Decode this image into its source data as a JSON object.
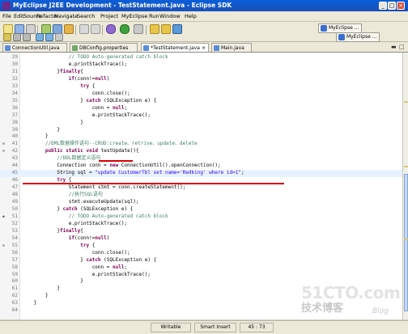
{
  "window": {
    "title": "MyEclipse J2EE Development - TestStatement.java - Eclipse SDK"
  },
  "menu": [
    "File",
    "Edit",
    "Source",
    "Refactor",
    "Navigate",
    "Search",
    "Project",
    "MyEclipse",
    "Run",
    "Window",
    "Help"
  ],
  "perspectives": [
    "MyEclipse ...",
    "MyEclipse ..."
  ],
  "tabs": [
    {
      "label": "ConnectionUtil.java",
      "icon": "java-file-icon",
      "active": false
    },
    {
      "label": "DBConfig.properties",
      "icon": "properties-file-icon",
      "active": false
    },
    {
      "label": "*TestStatement.java",
      "icon": "java-file-icon",
      "active": true
    },
    {
      "label": "Main.java",
      "icon": "java-file-icon",
      "active": false
    }
  ],
  "editor": {
    "lines": [
      {
        "n": "29",
        "text": "                // TODO Auto-generated catch block"
      },
      {
        "n": "30",
        "text": "                e.printStackTrace();"
      },
      {
        "n": "31",
        "text": "            }finally{"
      },
      {
        "n": "32",
        "text": "                if(conn!=null)"
      },
      {
        "n": "33",
        "text": "                    try {"
      },
      {
        "n": "34",
        "text": "                        conn.close();"
      },
      {
        "n": "35",
        "text": "                    } catch (SQLException e) {"
      },
      {
        "n": "36",
        "text": "                        conn = null;"
      },
      {
        "n": "37",
        "text": "                        e.printStackTrace();"
      },
      {
        "n": "38",
        "text": "                    }"
      },
      {
        "n": "39",
        "text": "            }"
      },
      {
        "n": "40",
        "text": "        }"
      },
      {
        "n": "41",
        "text": "        //DML数据操作语句--CRUD:create、retrive、update、delete"
      },
      {
        "n": "42",
        "text": "        public static void testUpdate(){"
      },
      {
        "n": "43",
        "text": "            //DDL数据定义语句"
      },
      {
        "n": "44",
        "text": "            Connection conn = new ConnectionUtil().openConnection();"
      },
      {
        "n": "45",
        "text": "            String sql = \"update CustomerTbl set name='Redking' where id=1\";"
      },
      {
        "n": "46",
        "text": "            try {"
      },
      {
        "n": "47",
        "text": "                Statement stmt = conn.createStatement();"
      },
      {
        "n": "48",
        "text": "                //执行SQL语句"
      },
      {
        "n": "49",
        "text": "                stmt.executeUpdate(sql);"
      },
      {
        "n": "50",
        "text": "            } catch (SQLException e) {"
      },
      {
        "n": "51",
        "text": "                // TODO Auto-generated catch block"
      },
      {
        "n": "52",
        "text": "                e.printStackTrace();"
      },
      {
        "n": "53",
        "text": "            }finally{"
      },
      {
        "n": "54",
        "text": "                if(conn!=null)"
      },
      {
        "n": "55",
        "text": "                    try {"
      },
      {
        "n": "56",
        "text": "                        conn.close();"
      },
      {
        "n": "57",
        "text": "                    } catch (SQLException e) {"
      },
      {
        "n": "58",
        "text": "                        conn = null;"
      },
      {
        "n": "59",
        "text": "                        e.printStackTrace();"
      },
      {
        "n": "60",
        "text": "                    }"
      },
      {
        "n": "61",
        "text": "            }"
      },
      {
        "n": "62",
        "text": "        }"
      },
      {
        "n": "63",
        "text": "    }"
      },
      {
        "n": "64",
        "text": ""
      }
    ],
    "current_line": "45"
  },
  "status": {
    "mode": "Writable",
    "insert": "Smart Insert",
    "position": "45 : 73"
  },
  "watermark": {
    "logo": "51CTO.com",
    "subtitle": "技术博客",
    "blog": "Blog"
  }
}
